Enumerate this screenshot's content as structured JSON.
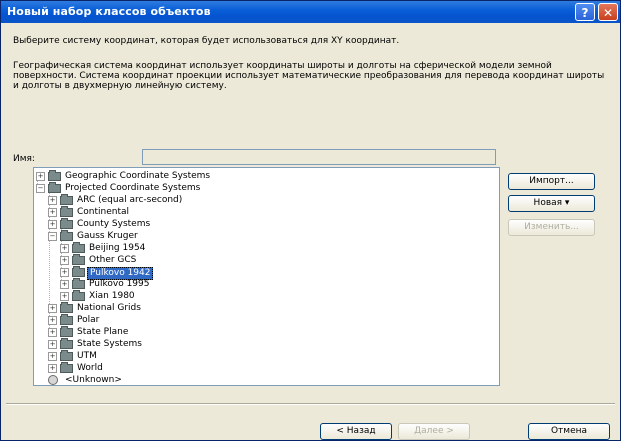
{
  "window": {
    "title": "Новый набор классов объектов"
  },
  "titlebar": {
    "help_glyph": "?",
    "close_glyph": "✕"
  },
  "intro": {
    "description": "Выберите систему координат, которая будет использоваться для XY координат.",
    "info": "Географическая система координат использует координаты широты и долготы на сферической модели земной поверхности. Система координат проекции использует математические преобразования для перевода координат широты и долготы в двухмерную линейную систему."
  },
  "name_field": {
    "label": "Имя:",
    "value": ""
  },
  "tree": {
    "items": [
      {
        "label": "Geographic Coordinate Systems",
        "icon": "folder-icon",
        "expander": "+"
      },
      {
        "label": "Projected Coordinate Systems",
        "icon": "folder-icon",
        "expander": "−"
      },
      {
        "label": "ARC (equal arc-second)",
        "icon": "folder-icon",
        "expander": "+"
      },
      {
        "label": "Continental",
        "icon": "folder-icon",
        "expander": "+"
      },
      {
        "label": "County Systems",
        "icon": "folder-icon",
        "expander": "+"
      },
      {
        "label": "Gauss Kruger",
        "icon": "folder-icon",
        "expander": "−"
      },
      {
        "label": "Beijing 1954",
        "icon": "folder-icon",
        "expander": "+"
      },
      {
        "label": "Other GCS",
        "icon": "folder-icon",
        "expander": "+"
      },
      {
        "label": "Pulkovo 1942",
        "icon": "folder-icon",
        "expander": "+",
        "selected": true
      },
      {
        "label": "Pulkovo 1995",
        "icon": "folder-icon",
        "expander": "+"
      },
      {
        "label": "Xian 1980",
        "icon": "folder-icon",
        "expander": "+"
      },
      {
        "label": "National Grids",
        "icon": "folder-icon",
        "expander": "+"
      },
      {
        "label": "Polar",
        "icon": "folder-icon",
        "expander": "+"
      },
      {
        "label": "State Plane",
        "icon": "folder-icon",
        "expander": "+"
      },
      {
        "label": "State Systems",
        "icon": "folder-icon",
        "expander": "+"
      },
      {
        "label": "UTM",
        "icon": "folder-icon",
        "expander": "+"
      },
      {
        "label": "World",
        "icon": "folder-icon",
        "expander": "+"
      },
      {
        "label": "<Unknown>",
        "icon": "globe-icon",
        "expander": ""
      }
    ]
  },
  "side_buttons": {
    "import": "Импорт...",
    "new": "Новая ▾",
    "modify": "Изменить..."
  },
  "footer": {
    "back": "< Назад",
    "next": "Далее >",
    "cancel": "Отмена"
  }
}
